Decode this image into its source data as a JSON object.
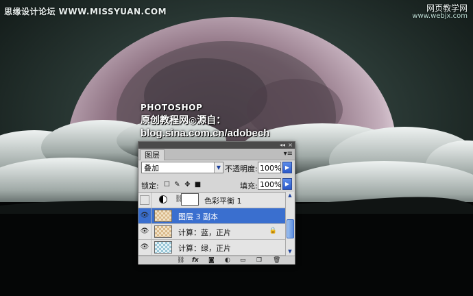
{
  "watermark": {
    "left": "思缘设计论坛 WWW.MISSYUAN.COM",
    "right_title": "网页教学网",
    "right_url": "www.webjx.com"
  },
  "credit": {
    "line1": "PHOTOSHOP",
    "line2": "原创教程网◎源自：",
    "line3": "blog.sina.com.cn/adobech"
  },
  "panel": {
    "tab": "图层",
    "blend_mode": "叠加",
    "opacity_label": "不透明度:",
    "opacity_value": "100%",
    "lock_label": "锁定:",
    "fill_label": "填充:",
    "fill_value": "100%",
    "layers": [
      {
        "name": "色彩平衡 1",
        "visible": false,
        "type": "adjustment"
      },
      {
        "name": "图层 3 副本",
        "visible": true,
        "selected": true
      },
      {
        "name": "计算：蓝，正片",
        "visible": true,
        "locked": true
      },
      {
        "name": "计算：绿，正片",
        "visible": true
      }
    ]
  },
  "icons": {
    "eye": "eye-icon",
    "lock": "lock-icon",
    "link": "link-icon",
    "fx": "fx-icon",
    "mask": "add-mask-icon",
    "adjustment": "adjustment-layer-icon",
    "group": "new-group-icon",
    "new_layer": "new-layer-icon",
    "trash": "trash-icon"
  }
}
